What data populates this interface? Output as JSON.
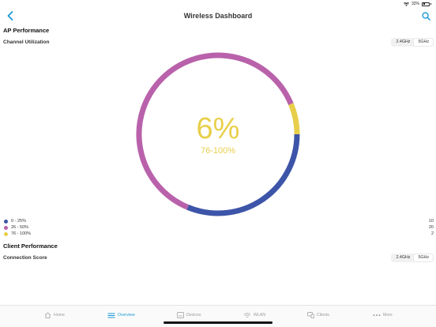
{
  "status": {
    "battery": "32%"
  },
  "header": {
    "title": "Wireless Dashboard"
  },
  "ap_performance": {
    "section_title": "AP Performance",
    "chart_title": "Channel Utilization",
    "band_options": [
      "2.4GHz",
      "5GHz"
    ],
    "selected_band": "5GHz",
    "center_value": "6%",
    "center_label": "76-100%"
  },
  "chart_data": {
    "type": "pie",
    "categories": [
      "0 - 25%",
      "26 - 50%",
      "76 - 100%"
    ],
    "values": [
      10,
      20,
      2
    ],
    "colors": [
      "#3d55a8",
      "#b962ab",
      "#e8cf4b"
    ],
    "style": "donut"
  },
  "legend": [
    {
      "label": "0 - 25%",
      "count": "10",
      "color": "#3d55a8"
    },
    {
      "label": "26 - 50%",
      "count": "20",
      "color": "#b962ab"
    },
    {
      "label": "76 - 100%",
      "count": "2",
      "color": "#e8cf4b"
    }
  ],
  "client_performance": {
    "section_title": "Client Performance",
    "chart_title": "Connection Score",
    "band_options": [
      "2.4GHz",
      "5GHz"
    ],
    "selected_band": "5GHz"
  },
  "tabs": [
    {
      "label": "Home",
      "icon": "home-icon",
      "active": false
    },
    {
      "label": "Overview",
      "icon": "list-icon",
      "active": true
    },
    {
      "label": "Devices",
      "icon": "devices-icon",
      "active": false
    },
    {
      "label": "WLAN",
      "icon": "wifi-icon",
      "active": false
    },
    {
      "label": "Clients",
      "icon": "clients-icon",
      "active": false
    },
    {
      "label": "More",
      "icon": "more-icon",
      "active": false
    }
  ],
  "colors": {
    "accent": "#1a9ad6",
    "inactive": "#9a9a9a"
  }
}
